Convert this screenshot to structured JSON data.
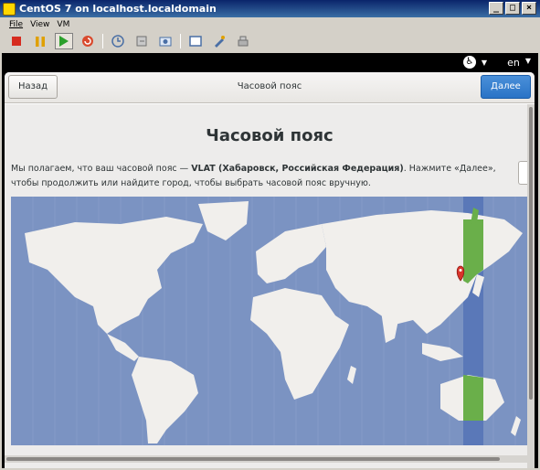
{
  "window": {
    "title": "CentOS 7 on localhost.localdomain",
    "buttons": [
      "_",
      "□",
      "×"
    ]
  },
  "menu": [
    "File",
    "View",
    "VM"
  ],
  "toolbar": {
    "icons": [
      "stop-icon",
      "pause-icon",
      "play-icon",
      "reset-icon",
      "snapshot-icon",
      "snapshot-revert-icon",
      "snapshot-manager-icon",
      "fullscreen-icon",
      "preferences-icon",
      "tools-icon"
    ]
  },
  "topbar": {
    "accessibility_symbol": "♿",
    "dropdown": "▼",
    "lang": "en",
    "lang_dropdown": "▼"
  },
  "header": {
    "back_label": "Назад",
    "title": "Часовой пояс",
    "next_label": "Далее"
  },
  "page": {
    "heading": "Часовой пояс",
    "desc_prefix": "Мы полагаем, что ваш часовой пояс — ",
    "desc_bold": "VLAT (Хабаровск, Российская Федерация)",
    "desc_suffix": ". Нажмите «Далее», чтобы продолжить или найдите город, чтобы выбрать часовой пояс вручную."
  },
  "colors": {
    "accent": "#2a73c6",
    "ocean": "#7b93c2",
    "land": "#f1efec",
    "selected_zone": "#6aaf4a",
    "highlight_band": "#5a78b8",
    "pin": "#d9342b"
  }
}
